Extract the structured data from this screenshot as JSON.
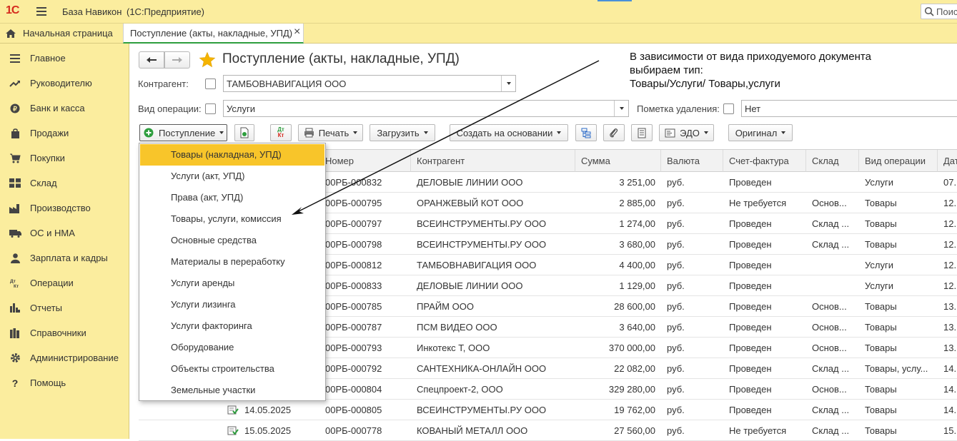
{
  "app": {
    "title": "База Навикон",
    "platform": "(1С:Предприятие)",
    "logo_text": "1С",
    "search_placeholder": "Поиск"
  },
  "tabs": [
    {
      "label": "Начальная страница"
    },
    {
      "label": "Поступление (акты, накладные, УПД)",
      "close": "×"
    }
  ],
  "sidebar": {
    "items": [
      {
        "label": "Главное",
        "icon": "menu-icon"
      },
      {
        "label": "Руководителю",
        "icon": "trend-icon"
      },
      {
        "label": "Банк и касса",
        "icon": "ruble-coin-icon"
      },
      {
        "label": "Продажи",
        "icon": "bag-icon"
      },
      {
        "label": "Покупки",
        "icon": "cart-icon"
      },
      {
        "label": "Склад",
        "icon": "warehouse-icon"
      },
      {
        "label": "Производство",
        "icon": "factory-icon"
      },
      {
        "label": "ОС и НМА",
        "icon": "truck-icon"
      },
      {
        "label": "Зарплата и кадры",
        "icon": "person-icon"
      },
      {
        "label": "Операции",
        "icon": "dt-kt-icon"
      },
      {
        "label": "Отчеты",
        "icon": "bar-chart-icon"
      },
      {
        "label": "Справочники",
        "icon": "books-icon"
      },
      {
        "label": "Администрирование",
        "icon": "gear-icon"
      },
      {
        "label": "Помощь",
        "icon": "question-icon"
      }
    ]
  },
  "page": {
    "title": "Поступление (акты, накладные, УПД)"
  },
  "filters": {
    "counterparty_label": "Контрагент:",
    "counterparty_value": "ТАМБОВНАВИГАЦИЯ ООО",
    "operation_label": "Вид операции:",
    "operation_value": "Услуги",
    "deletion_label": "Пометка удаления:",
    "deletion_value": "Нет"
  },
  "toolbar": {
    "receipt_label": "Поступление",
    "dt_kt_label": "ДтКт",
    "print_label": "Печать",
    "load_label": "Загрузить",
    "create_based_label": "Создать на основании",
    "edo_label": "ЭДО",
    "original_label": "Оригинал"
  },
  "annotation": {
    "lines": [
      "В зависимости от вида приходуемого документа",
      "выбираем тип:",
      "Товары/Услуги/ Товары,услуги"
    ]
  },
  "dropdown": {
    "items": [
      "Товары (накладная, УПД)",
      "Услуги (акт, УПД)",
      "Права (акт, УПД)",
      "Товары, услуги, комиссия",
      "Основные средства",
      "Материалы в переработку",
      "Услуги аренды",
      "Услуги лизинга",
      "Услуги факторинга",
      "Оборудование",
      "Объекты строительства",
      "Земельные участки"
    ],
    "selected_index": 0
  },
  "table": {
    "columns": [
      "Номер",
      "Контрагент",
      "Сумма",
      "Валюта",
      "Счет-фактура",
      "Склад",
      "Вид операции",
      "Дат"
    ],
    "rows": [
      {
        "date": "",
        "number": "00РБ-000832",
        "counterparty": "ДЕЛОВЫЕ ЛИНИИ ООО",
        "sum": "3 251,00",
        "currency": "руб.",
        "invoice": "Проведен",
        "warehouse": "",
        "operation": "Услуги",
        "date2": "07."
      },
      {
        "date": "",
        "number": "00РБ-000795",
        "counterparty": "ОРАНЖЕВЫЙ КОТ ООО",
        "sum": "2 885,00",
        "currency": "руб.",
        "invoice": "Не требуется",
        "warehouse": "Основ...",
        "operation": "Товары",
        "date2": "12."
      },
      {
        "date": "",
        "number": "00РБ-000797",
        "counterparty": "ВСЕИНСТРУМЕНТЫ.РУ ООО",
        "sum": "1 274,00",
        "currency": "руб.",
        "invoice": "Проведен",
        "warehouse": "Склад ...",
        "operation": "Товары",
        "date2": "12."
      },
      {
        "date": "",
        "number": "00РБ-000798",
        "counterparty": "ВСЕИНСТРУМЕНТЫ.РУ ООО",
        "sum": "3 680,00",
        "currency": "руб.",
        "invoice": "Проведен",
        "warehouse": "Склад ...",
        "operation": "Товары",
        "date2": "12."
      },
      {
        "date": "",
        "number": "00РБ-000812",
        "counterparty": "ТАМБОВНАВИГАЦИЯ ООО",
        "sum": "4 400,00",
        "currency": "руб.",
        "invoice": "Проведен",
        "warehouse": "",
        "operation": "Услуги",
        "date2": "12."
      },
      {
        "date": "",
        "number": "00РБ-000833",
        "counterparty": "ДЕЛОВЫЕ ЛИНИИ ООО",
        "sum": "1 129,00",
        "currency": "руб.",
        "invoice": "Проведен",
        "warehouse": "",
        "operation": "Услуги",
        "date2": "12."
      },
      {
        "date": "",
        "number": "00РБ-000785",
        "counterparty": "ПРАЙМ ООО",
        "sum": "28 600,00",
        "currency": "руб.",
        "invoice": "Проведен",
        "warehouse": "Основ...",
        "operation": "Товары",
        "date2": "13."
      },
      {
        "date": "",
        "number": "00РБ-000787",
        "counterparty": "ПСМ ВИДЕО ООО",
        "sum": "3 640,00",
        "currency": "руб.",
        "invoice": "Проведен",
        "warehouse": "Основ...",
        "operation": "Товары",
        "date2": "13."
      },
      {
        "date": "",
        "number": "00РБ-000793",
        "counterparty": "Инкотекс Т, ООО",
        "sum": "370 000,00",
        "currency": "руб.",
        "invoice": "Проведен",
        "warehouse": "Основ...",
        "operation": "Товары",
        "date2": "13."
      },
      {
        "date": "",
        "number": "00РБ-000792",
        "counterparty": "САНТЕХНИКА-ОНЛАЙН ООО",
        "sum": "22 082,00",
        "currency": "руб.",
        "invoice": "Проведен",
        "warehouse": "Склад ...",
        "operation": "Товары, услу...",
        "date2": "14."
      },
      {
        "date": "",
        "number": "00РБ-000804",
        "counterparty": "Спецпроект-2, ООО",
        "sum": "329 280,00",
        "currency": "руб.",
        "invoice": "Проведен",
        "warehouse": "Основ...",
        "operation": "Товары",
        "date2": "14."
      },
      {
        "date": "14.05.2025",
        "number": "00РБ-000805",
        "counterparty": "ВСЕИНСТРУМЕНТЫ.РУ ООО",
        "sum": "19 762,00",
        "currency": "руб.",
        "invoice": "Проведен",
        "warehouse": "Склад ...",
        "operation": "Товары",
        "date2": "14."
      },
      {
        "date": "15.05.2025",
        "number": "00РБ-000778",
        "counterparty": "КОВАНЫЙ МЕТАЛЛ ООО",
        "sum": "27 560,00",
        "currency": "руб.",
        "invoice": "Не требуется",
        "warehouse": "Склад ...",
        "operation": "Товары",
        "date2": "15."
      }
    ]
  },
  "colors": {
    "accent_yellow": "#fbed9e",
    "selected": "#f8c52a",
    "star": "#f5b400",
    "logo_red": "#d52b1e",
    "doc_green": "#2e9e3e"
  }
}
